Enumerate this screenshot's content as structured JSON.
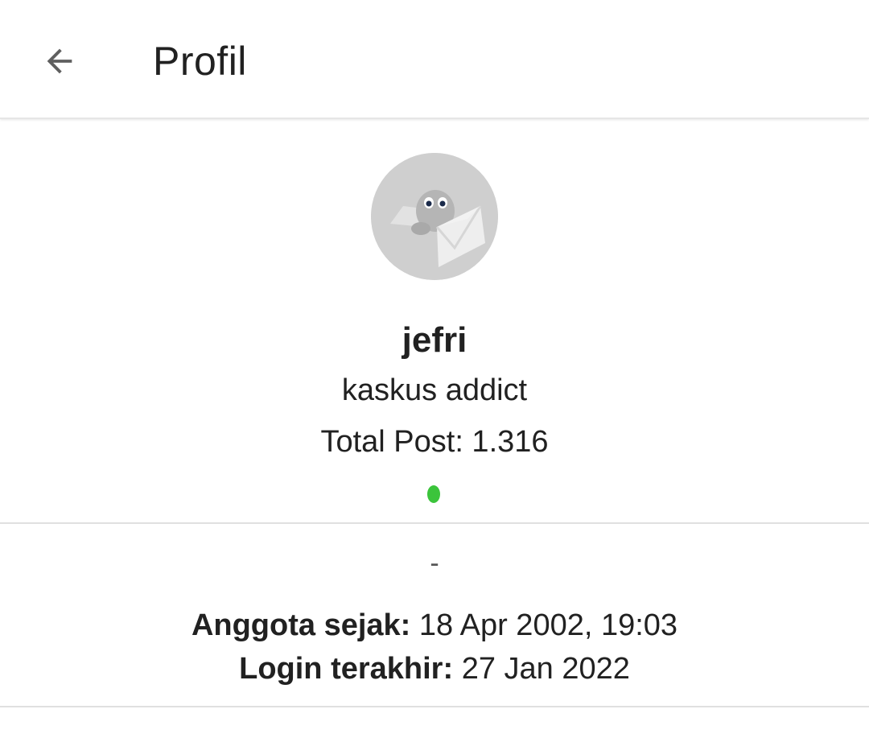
{
  "header": {
    "title": "Profil",
    "back_icon": "arrow-left-icon"
  },
  "profile": {
    "avatar_icon": "kaskus-default-avatar-icon",
    "username": "jefri",
    "rank": "kaskus addict",
    "total_post": "Total Post: 1.316",
    "online_status_color": "#3bc43b"
  },
  "details": {
    "bio": "-",
    "member_since_label": "Anggota sejak:",
    "member_since_value": " 18 Apr 2002, 19:03",
    "last_login_label": "Login terakhir:",
    "last_login_value": " 27 Jan 2022"
  }
}
